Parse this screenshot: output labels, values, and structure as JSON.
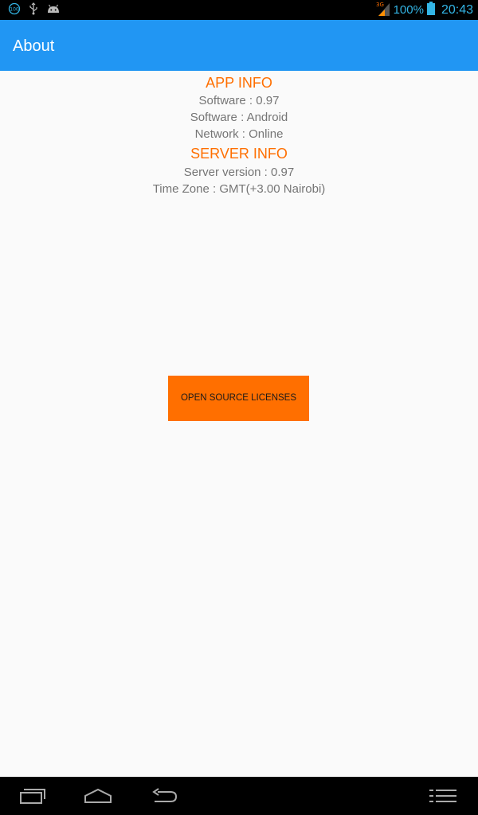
{
  "status_bar": {
    "notification_icons": [
      "circle-100-icon",
      "usb-icon",
      "android-icon"
    ],
    "network_type": "3G",
    "battery_percent": "100%",
    "battery_level": 1.0,
    "time": "20:43"
  },
  "app_bar": {
    "title": "About"
  },
  "app_info": {
    "heading": "APP INFO",
    "software_version": "Software : 0.97",
    "software_platform": "Software : Android",
    "network": "Network : Online"
  },
  "server_info": {
    "heading": "SERVER INFO",
    "server_version": "Server version : 0.97",
    "time_zone": "Time Zone : GMT(+3.00 Nairobi)"
  },
  "actions": {
    "licenses_button": "OPEN SOURCE LICENSES"
  },
  "nav_bar": {
    "icons": [
      "recent-apps-icon",
      "home-icon",
      "back-icon",
      "menu-icon"
    ]
  },
  "colors": {
    "app_bar": "#2196f3",
    "accent": "#ff6f00",
    "status_text": "#33b5e5",
    "body_text": "#757575"
  }
}
